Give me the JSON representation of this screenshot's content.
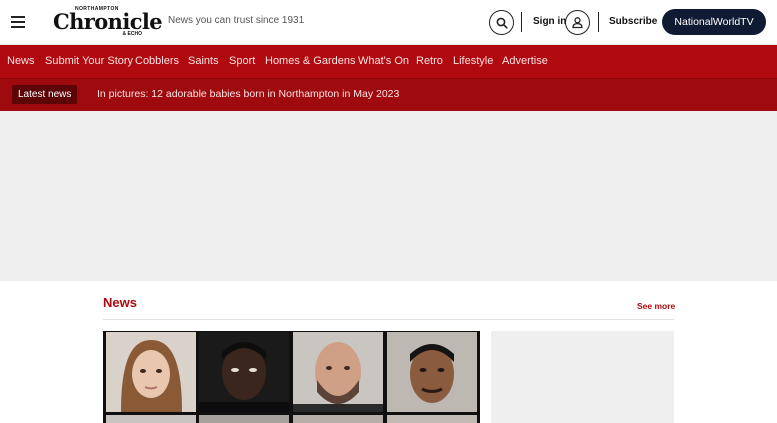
{
  "header": {
    "menu_icon": "hamburger-menu-icon",
    "logo_small": "NORTHAMPTON",
    "logo_main": "Chronicle",
    "logo_sub": "& ECHO",
    "tagline": "News you can trust since 1931",
    "search_icon": "search-icon",
    "signin_label": "Sign in",
    "user_icon": "user-icon",
    "subscribe_label": "Subscribe",
    "tv_button_label": "NationalWorldTV"
  },
  "nav": {
    "items": [
      {
        "label": "News"
      },
      {
        "label": "Submit Your Story"
      },
      {
        "label": "Cobblers"
      },
      {
        "label": "Saints"
      },
      {
        "label": "Sport"
      },
      {
        "label": "Homes & Gardens"
      },
      {
        "label": "What's On"
      },
      {
        "label": "Retro"
      },
      {
        "label": "Lifestyle"
      },
      {
        "label": "Advertise"
      }
    ]
  },
  "latest": {
    "label": "Latest news",
    "headline": "In pictures: 12 adorable babies born in Northampton in May 2023"
  },
  "news_section": {
    "title": "News",
    "see_more": "See more"
  },
  "colors": {
    "brand_red": "#b0090f",
    "latest_bar": "#9e0a0e",
    "tv_button": "#0f1a33"
  }
}
